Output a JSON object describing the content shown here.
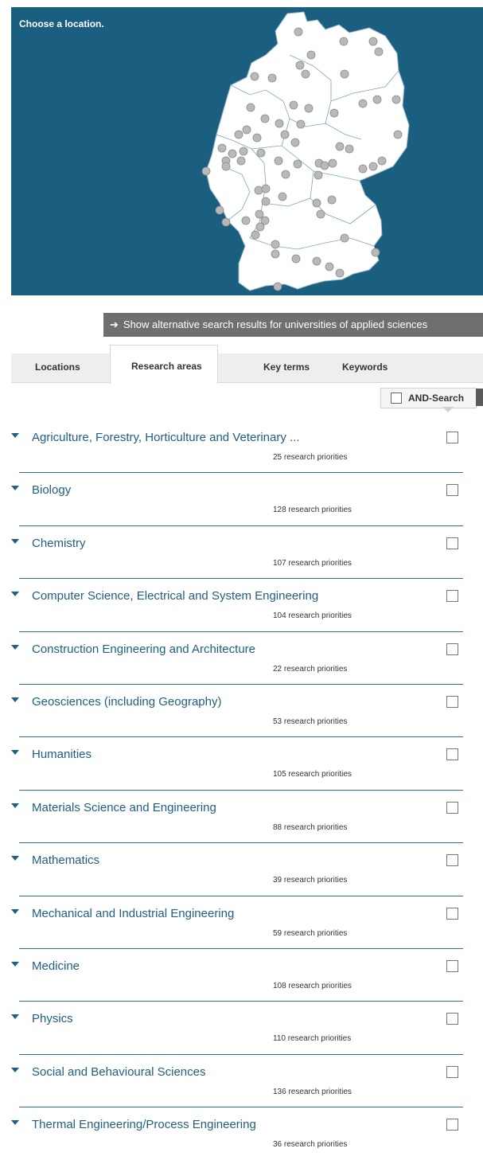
{
  "map": {
    "title": "Choose a location.",
    "colors": {
      "water": "#1a5e80",
      "land": "#ffffff",
      "marker": "#b9b9b9"
    }
  },
  "alt_search": {
    "arrow_icon": "arrow-right-icon",
    "label": "Show alternative search results for universities of applied sciences"
  },
  "tabs": [
    {
      "label": "Locations",
      "active": false
    },
    {
      "label": "Research areas",
      "active": true
    },
    {
      "label": "Key terms",
      "active": false
    },
    {
      "label": "Keywords",
      "active": false
    }
  ],
  "and_search": {
    "label": "AND-Search",
    "checked": false
  },
  "areas": [
    {
      "name": "Agriculture, Forestry, Horticulture and Veterinary ...",
      "count": "25 research priorities"
    },
    {
      "name": "Biology",
      "count": "128 research priorities"
    },
    {
      "name": "Chemistry",
      "count": "107 research priorities"
    },
    {
      "name": "Computer Science, Electrical and System Engineering",
      "count": "104 research priorities"
    },
    {
      "name": "Construction Engineering and Architecture",
      "count": "22 research priorities"
    },
    {
      "name": "Geosciences (including Geography)",
      "count": "53 research priorities"
    },
    {
      "name": "Humanities",
      "count": "105 research priorities"
    },
    {
      "name": "Materials Science and Engineering",
      "count": "88 research priorities"
    },
    {
      "name": "Mathematics",
      "count": "39 research priorities"
    },
    {
      "name": "Mechanical and Industrial Engineering",
      "count": "59 research priorities"
    },
    {
      "name": "Medicine",
      "count": "108 research priorities"
    },
    {
      "name": "Physics",
      "count": "110 research priorities"
    },
    {
      "name": "Social and Behavioural Sciences",
      "count": "136 research priorities"
    },
    {
      "name": "Thermal Engineering/Process Engineering",
      "count": "36 research priorities"
    }
  ]
}
